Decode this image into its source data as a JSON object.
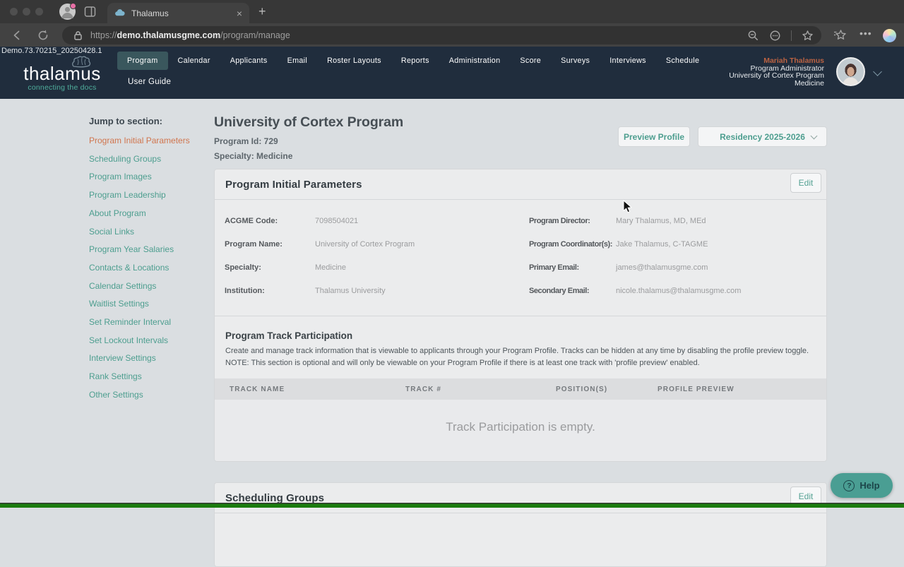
{
  "browser": {
    "tab_title": "Thalamus",
    "url_scheme": "https://",
    "url_host": "demo.thalamusgme.com",
    "url_path": "/program/manage"
  },
  "header": {
    "build": "Demo.73.70215_20250428.1",
    "logo": "thalamus",
    "tagline": "connecting the docs",
    "nav": [
      "Program",
      "Calendar",
      "Applicants",
      "Email",
      "Roster Layouts",
      "Reports",
      "Administration",
      "Score",
      "Surveys",
      "Interviews",
      "Schedule"
    ],
    "nav_active_index": 0,
    "nav_row2": "User Guide",
    "user": {
      "name": "Mariah Thalamus",
      "role": "Program Administrator",
      "program": "University of Cortex Program",
      "specialty": "Medicine"
    }
  },
  "sidebar": {
    "heading": "Jump to section:",
    "active_index": 0,
    "items": [
      "Program Initial Parameters",
      "Scheduling Groups",
      "Program Images",
      "Program Leadership",
      "About Program",
      "Social Links",
      "Program Year Salaries",
      "Contacts & Locations",
      "Calendar Settings",
      "Waitlist Settings",
      "Set Reminder Interval",
      "Set Lockout Intervals",
      "Interview Settings",
      "Rank Settings",
      "Other Settings"
    ]
  },
  "page": {
    "title": "University of Cortex Program",
    "id_line": "Program Id: 729",
    "specialty_line": "Specialty: Medicine",
    "preview_button": "Preview Profile",
    "season_dropdown": "Residency 2025-2026"
  },
  "card_params": {
    "title": "Program Initial Parameters",
    "edit_button": "Edit",
    "fields_left": [
      {
        "label": "ACGME Code:",
        "value": "7098504021"
      },
      {
        "label": "Program Name:",
        "value": "University of Cortex Program"
      },
      {
        "label": "Specialty:",
        "value": "Medicine"
      },
      {
        "label": "Institution:",
        "value": "Thalamus University"
      }
    ],
    "fields_right": [
      {
        "label": "Program Director:",
        "value": "Mary Thalamus, MD, MEd"
      },
      {
        "label": "Program Coordinator(s):",
        "value": "Jake Thalamus, C-TAGME"
      },
      {
        "label": "Primary Email:",
        "value": "james@thalamusgme.com"
      },
      {
        "label": "Secondary Email:",
        "value": "nicole.thalamus@thalamusgme.com"
      }
    ]
  },
  "track": {
    "title": "Program Track Participation",
    "desc1": "Create and manage track information that is viewable to applicants through your Program Profile. Tracks can be hidden at any time by disabling the profile preview toggle.",
    "desc2": "NOTE: This section is optional and will only be viewable on your Program Profile if there is at least one track with 'profile preview' enabled.",
    "columns": [
      "TRACK NAME",
      "TRACK #",
      "POSITION(S)",
      "PROFILE PREVIEW"
    ],
    "empty_message": "Track Participation is empty."
  },
  "card_scheduling": {
    "title": "Scheduling Groups",
    "edit_button": "Edit"
  },
  "help_button": {
    "label": "Help"
  },
  "colors": {
    "teal": "#4d9e8f",
    "orange": "#d0754e",
    "header_bg": "#202d3d",
    "page_bg": "#dadee1",
    "help_bg": "#4a9e93",
    "bottom_strip": "#1a7c0e"
  }
}
